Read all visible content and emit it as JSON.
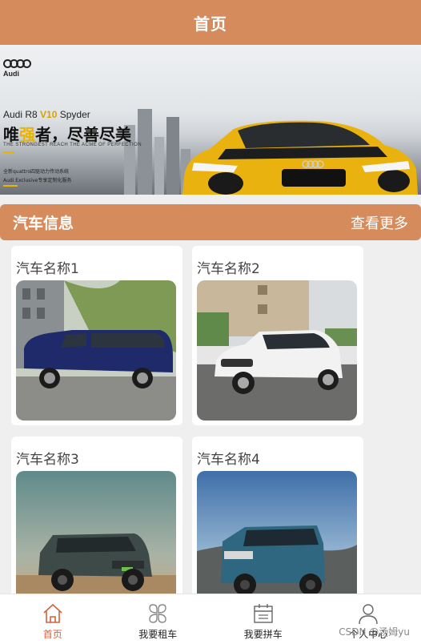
{
  "header": {
    "title": "首页"
  },
  "banner": {
    "brand": "Audi",
    "model_prefix": "Audi R8",
    "model_highlight": "V10",
    "model_suffix": "Spyder",
    "slogan_a": "唯",
    "slogan_highlight": "强",
    "slogan_b": "者，尽善尽美",
    "slogan_en": "THE STRONGEST REACH THE ACME OF PERFECTION",
    "feature_1": "全新quattro四驱动力传动系统",
    "feature_2": "Audi Exclusive专享定制化服务",
    "plate": "Audi",
    "accent_color": "#e8b400"
  },
  "section": {
    "title": "汽车信息",
    "more": "查看更多"
  },
  "cars": [
    {
      "name": "汽车名称1"
    },
    {
      "name": "汽车名称2"
    },
    {
      "name": "汽车名称3"
    },
    {
      "name": "汽车名称4"
    }
  ],
  "tabbar": {
    "items": [
      {
        "label": "首页",
        "icon": "home-icon",
        "active": true
      },
      {
        "label": "我要租车",
        "icon": "grid-flower-icon",
        "active": false
      },
      {
        "label": "我要拼车",
        "icon": "calendar-icon",
        "active": false
      },
      {
        "label": "个人中心",
        "icon": "user-icon",
        "active": false
      }
    ]
  },
  "watermark": "CSDN @汤姆yu",
  "colors": {
    "primary": "#d68b5c",
    "active_tab": "#d4603a"
  }
}
